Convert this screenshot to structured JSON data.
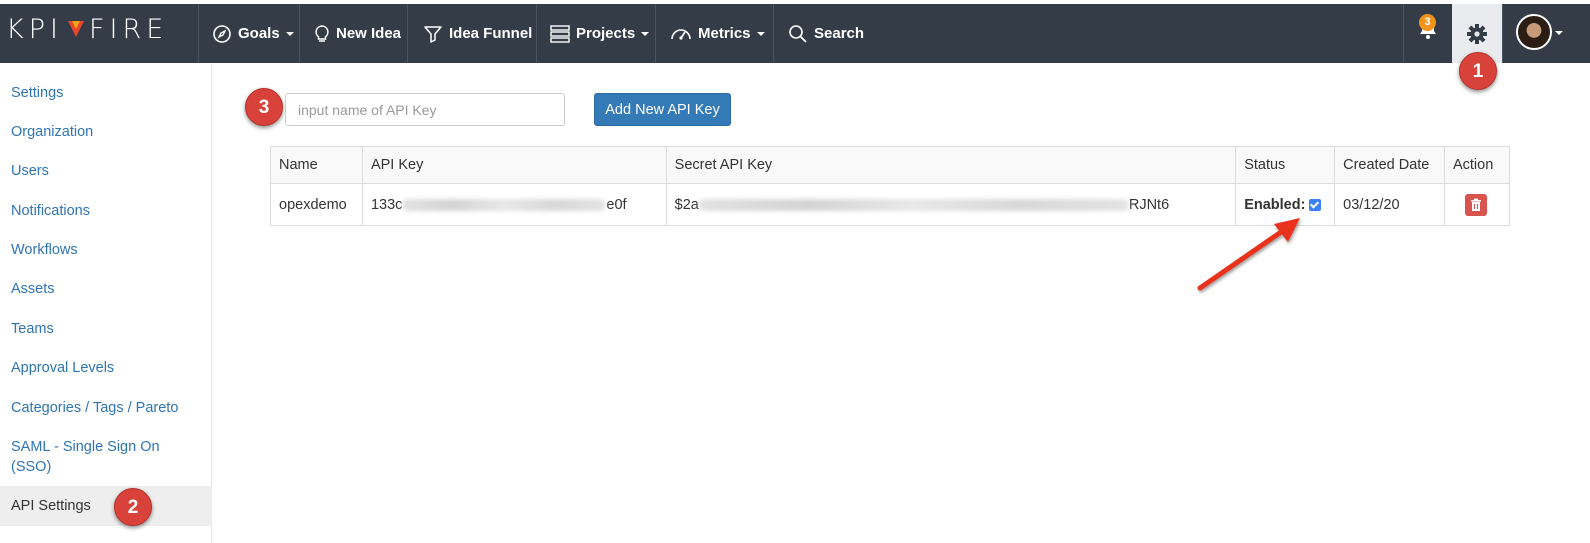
{
  "nav": {
    "logo": "KPI FIRE",
    "items": [
      {
        "label": "Goals",
        "icon": "compass-icon",
        "dropdown": true
      },
      {
        "label": "New Idea",
        "icon": "lightbulb-icon",
        "dropdown": false
      },
      {
        "label": "Idea Funnel",
        "icon": "funnel-icon",
        "dropdown": false
      },
      {
        "label": "Projects",
        "icon": "server-icon",
        "dropdown": true
      },
      {
        "label": "Metrics",
        "icon": "dashboard-icon",
        "dropdown": true
      },
      {
        "label": "Search",
        "icon": "search-icon",
        "dropdown": false
      }
    ],
    "notification_count": "3"
  },
  "sidebar": {
    "items": [
      {
        "label": "Settings"
      },
      {
        "label": "Organization"
      },
      {
        "label": "Users"
      },
      {
        "label": "Notifications"
      },
      {
        "label": "Workflows"
      },
      {
        "label": "Assets"
      },
      {
        "label": "Teams"
      },
      {
        "label": "Approval Levels"
      },
      {
        "label": "Categories / Tags / Pareto"
      },
      {
        "label": "SAML - Single Sign On (SSO)"
      },
      {
        "label": "API Settings",
        "active": true
      }
    ]
  },
  "callouts": {
    "one": "1",
    "two": "2",
    "three": "3"
  },
  "api_form": {
    "placeholder": "input name of API Key",
    "add_button": "Add New API Key"
  },
  "table": {
    "headers": [
      "Name",
      "API Key",
      "Secret API Key",
      "Status",
      "Created Date",
      "Action"
    ],
    "rows": [
      {
        "name": "opexdemo",
        "api_key_start": "133c",
        "api_key_end": "e0f",
        "secret_start": "$2a",
        "secret_end": "RJNt6",
        "status_label": "Enabled:",
        "enabled": true,
        "created": "03/12/20"
      }
    ]
  },
  "colors": {
    "navbar": "#333c47",
    "link": "#2f75b5",
    "primary_button": "#337ab7",
    "callout": "#d9423b",
    "delete": "#d9534f"
  }
}
